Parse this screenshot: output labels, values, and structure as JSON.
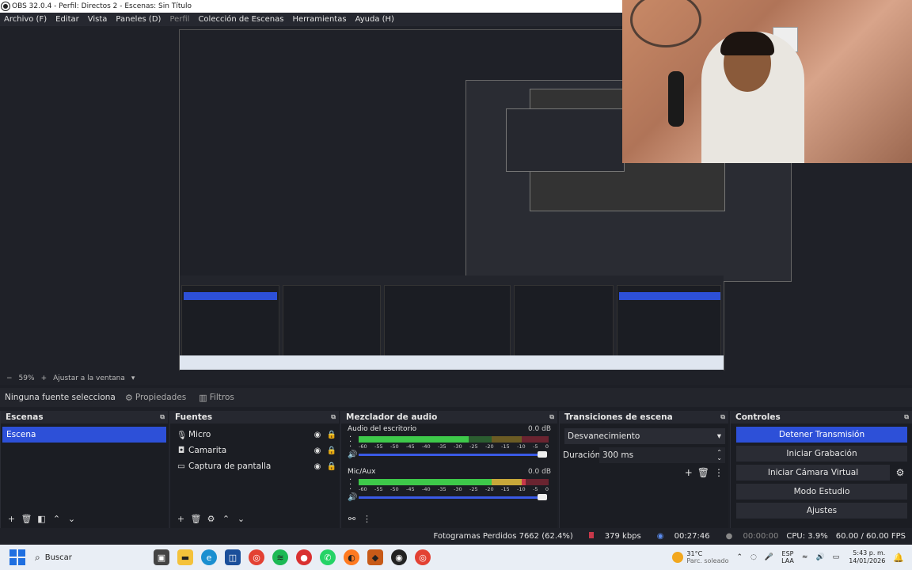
{
  "window": {
    "title": "OBS 32.0.4 - Perfil: Directos 2 - Escenas: Sin Título"
  },
  "menu": [
    "Archivo (F)",
    "Editar",
    "Vista",
    "Paneles (D)",
    "Perfil",
    "Colección de Escenas",
    "Herramientas",
    "Ayuda (H)"
  ],
  "zoom": {
    "percent": "59%",
    "fit": "Ajustar a la ventana"
  },
  "properties_bar": {
    "no_selection": "Ninguna fuente selecciona",
    "properties": "Propiedades",
    "filters": "Filtros"
  },
  "docks": {
    "scenes": {
      "title": "Escenas",
      "items": [
        "Escena"
      ]
    },
    "sources": {
      "title": "Fuentes",
      "items": [
        {
          "icon": "microphone-icon",
          "label": "Micro"
        },
        {
          "icon": "camera-icon",
          "label": "Camarita"
        },
        {
          "icon": "monitor-icon",
          "label": "Captura de pantalla"
        }
      ]
    },
    "mixer": {
      "title": "Mezclador de audio",
      "tracks": [
        {
          "name": "Audio del escritorio",
          "db": "0.0 dB",
          "volume": 1.0
        },
        {
          "name": "Mic/Aux",
          "db": "0.0 dB",
          "volume": 1.0
        }
      ],
      "scale": [
        "-60",
        "-55",
        "-50",
        "-45",
        "-40",
        "-35",
        "-30",
        "-25",
        "-20",
        "-15",
        "-10",
        "-5",
        "0"
      ]
    },
    "transitions": {
      "title": "Transiciones de escena",
      "selected": "Desvanecimiento",
      "duration_label": "Duración",
      "duration_value": "300 ms"
    },
    "controls": {
      "title": "Controles",
      "stop_stream": "Detener Transmisión",
      "start_recording": "Iniciar Grabación",
      "start_virtual_cam": "Iniciar Cámara Virtual",
      "studio_mode": "Modo Estudio",
      "settings": "Ajustes"
    }
  },
  "status": {
    "dropped_frames": "Fotogramas Perdidos 7662 (62.4%)",
    "bitrate": "379 kbps",
    "stream_time": "00:27:46",
    "record_time": "00:00:00",
    "cpu": "CPU: 3.9%",
    "fps": "60.00 / 60.00 FPS"
  },
  "taskbar": {
    "search": "Buscar",
    "weather_temp": "31°C",
    "weather_desc": "Parc. soleado",
    "lang_top": "ESP",
    "lang_bottom": "LAA",
    "time": "5:43 p. m.",
    "date": "14/01/2026"
  },
  "colors": {
    "accent": "#2d50d8",
    "panel": "#1b1d23",
    "background": "#1f2128"
  }
}
